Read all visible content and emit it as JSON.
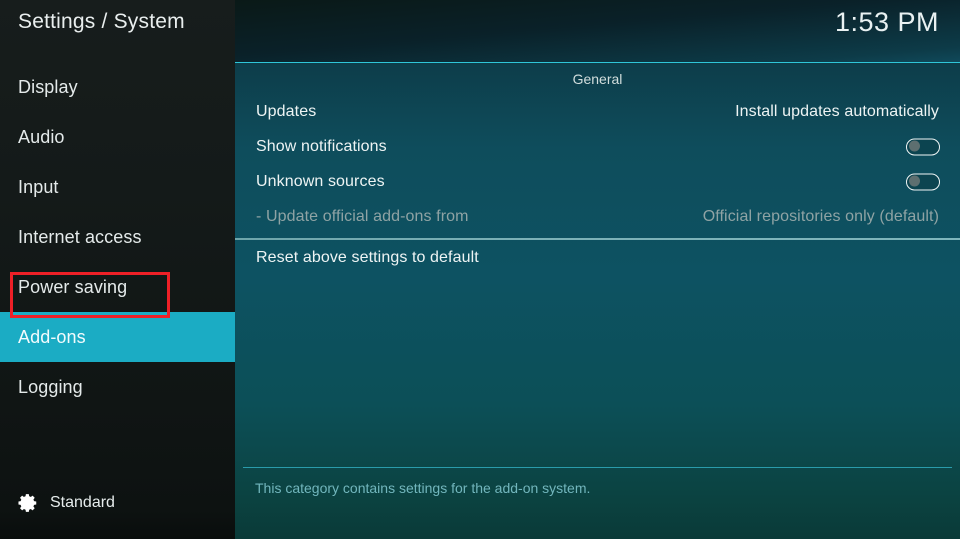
{
  "window": {
    "title": "Settings / System",
    "clock": "1:53 PM"
  },
  "sidebar": {
    "items": [
      {
        "label": "Display",
        "name": "display",
        "selected": false
      },
      {
        "label": "Audio",
        "name": "audio",
        "selected": false
      },
      {
        "label": "Input",
        "name": "input",
        "selected": false
      },
      {
        "label": "Internet access",
        "name": "internet-access",
        "selected": false
      },
      {
        "label": "Power saving",
        "name": "power-saving",
        "selected": false
      },
      {
        "label": "Add-ons",
        "name": "add-ons",
        "selected": true
      },
      {
        "label": "Logging",
        "name": "logging",
        "selected": false
      }
    ],
    "status": {
      "icon": "gear-icon",
      "label": "Standard"
    }
  },
  "main": {
    "section_title": "General",
    "rows": [
      {
        "label": "Updates",
        "name": "updates",
        "control": "value",
        "value": "Install updates automatically",
        "disabled": false
      },
      {
        "label": "Show notifications",
        "name": "show-notifications",
        "control": "toggle",
        "value": "off",
        "disabled": false
      },
      {
        "label": "Unknown sources",
        "name": "unknown-sources",
        "control": "toggle",
        "value": "off",
        "disabled": false
      },
      {
        "label": "- Update official add-ons from",
        "name": "update-official-add-ons-from",
        "control": "value",
        "value": "Official repositories only (default)",
        "disabled": true
      }
    ],
    "reset_label": "Reset above settings to default",
    "description": "This category contains settings for the add-on system."
  },
  "annotation": {
    "target": "add-ons",
    "color": "#ee2027"
  },
  "colors": {
    "accent": "#1bacc4",
    "panel_mid": "#0d5262",
    "sidebar_bg": "#141a19",
    "rule": "#2fc6d8",
    "annotation": "#ee2027",
    "description_text": "#72b6bd",
    "disabled_text": "#8fa3a4"
  }
}
